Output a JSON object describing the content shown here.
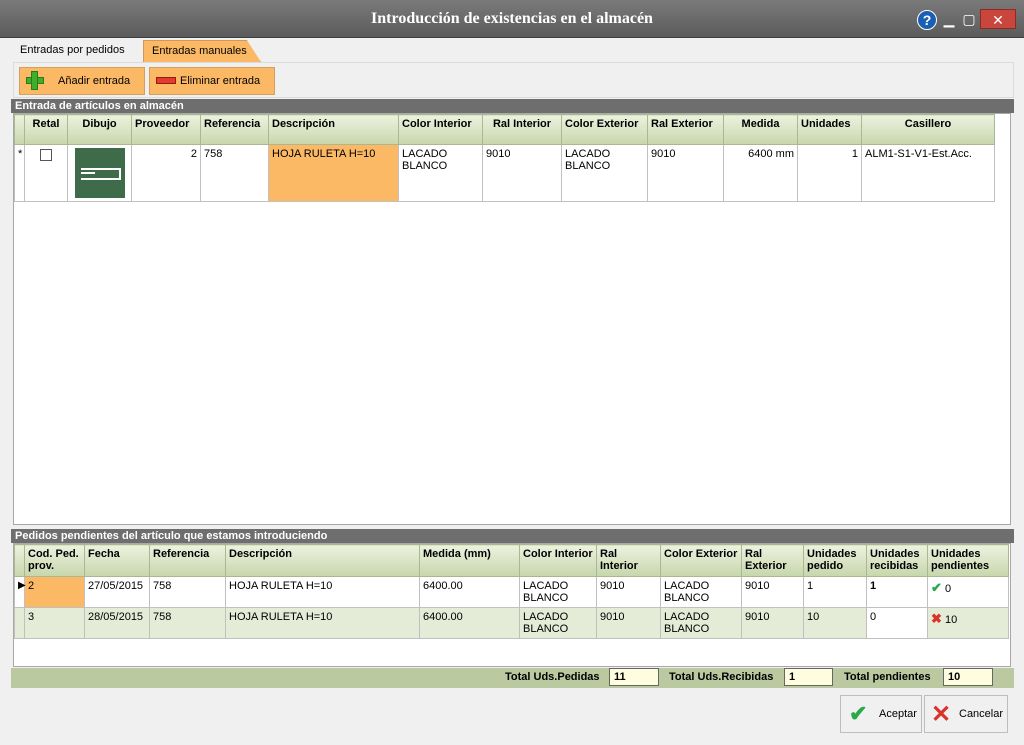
{
  "window": {
    "title": "Introducción de existencias en el almacén",
    "help_glyph": "?",
    "min_glyph": "▁",
    "max_glyph": "▢",
    "close_glyph": "✕"
  },
  "tabs": [
    {
      "label": "Entradas por pedidos",
      "active": false
    },
    {
      "label": "Entradas manuales",
      "active": true
    }
  ],
  "toolbar": {
    "add_label": "Añadir entrada",
    "delete_label": "Eliminar entrada"
  },
  "entry_section": {
    "title": "Entrada de artículos en almacén",
    "columns": [
      "Retal",
      "Dibujo",
      "Proveedor",
      "Referencia",
      "Descripción",
      "Color Interior",
      "Ral Interior",
      "Color Exterior",
      "Ral Exterior",
      "Medida",
      "Unidades",
      "Casillero"
    ],
    "rows": [
      {
        "marker": "*",
        "retal": false,
        "proveedor": "2",
        "referencia": "758",
        "descripcion": "HOJA RULETA H=10",
        "color_interior": "LACADO BLANCO",
        "ral_interior": "9010",
        "color_exterior": "LACADO BLANCO",
        "ral_exterior": "9010",
        "medida": "6400 mm",
        "unidades": "1",
        "casillero": "ALM1-S1-V1-Est.Acc."
      }
    ]
  },
  "pending_section": {
    "title": "Pedidos pendientes del artículo que estamos introduciendo",
    "columns": [
      "Cod. Ped. prov.",
      "Fecha",
      "Referencia",
      "Descripción",
      "Medida (mm)",
      "Color Interior",
      "Ral Interior",
      "Color Exterior",
      "Ral Exterior",
      "Unidades pedido",
      "Unidades recibidas",
      "Unidades pendientes"
    ],
    "rows": [
      {
        "cod": "2",
        "fecha": "27/05/2015",
        "referencia": "758",
        "descripcion": "HOJA RULETA H=10",
        "medida": "6400.00",
        "color_interior": "LACADO BLANCO",
        "ral_interior": "9010",
        "color_exterior": "LACADO BLANCO",
        "ral_exterior": "9010",
        "pedido": "1",
        "recibidas": "1",
        "pendientes": "0",
        "status_icon": "check-icon"
      },
      {
        "cod": "3",
        "fecha": "28/05/2015",
        "referencia": "758",
        "descripcion": "HOJA RULETA H=10",
        "medida": "6400.00",
        "color_interior": "LACADO BLANCO",
        "ral_interior": "9010",
        "color_exterior": "LACADO BLANCO",
        "ral_exterior": "9010",
        "pedido": "10",
        "recibidas": "0",
        "pendientes": "10",
        "status_icon": "cross-icon"
      }
    ]
  },
  "totals": {
    "pedidas_label": "Total Uds.Pedidas",
    "pedidas_value": "11",
    "recibidas_label": "Total Uds.Recibidas",
    "recibidas_value": "1",
    "pendientes_label": "Total pendientes",
    "pendientes_value": "10"
  },
  "footer": {
    "ok_label": "Aceptar",
    "cancel_label": "Cancelar"
  },
  "colors": {
    "accent_orange": "#fbb966",
    "header_green": "#c7d6ac",
    "title_gray": "#6e6e6e",
    "ok_green": "#2aa84a",
    "cancel_red": "#d9332a"
  }
}
